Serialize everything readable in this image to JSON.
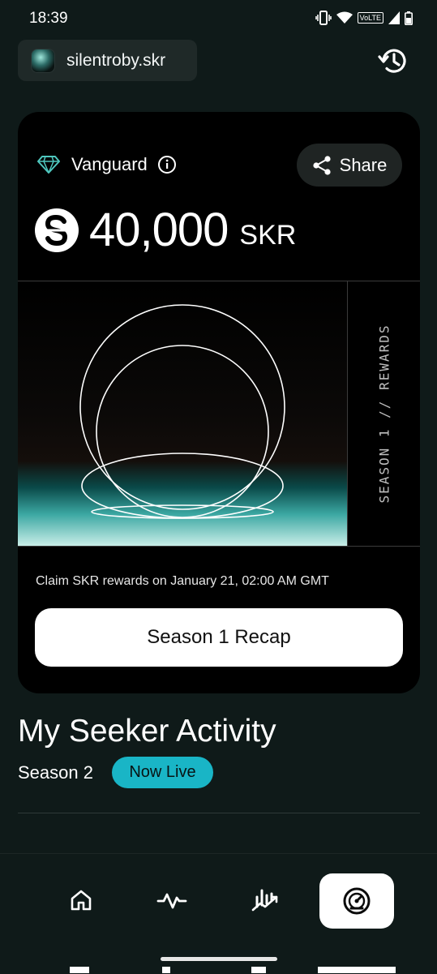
{
  "status_bar": {
    "time": "18:39",
    "network_label": "VoLTE"
  },
  "header": {
    "profile_name": "silentroby.skr",
    "icons": [
      "avatar-image",
      "history-icon"
    ]
  },
  "card": {
    "tier_label": "Vanguard",
    "share_label": "Share",
    "amount_value": "40,000",
    "amount_unit": "SKR",
    "artwork_side_text": "SEASON 1 // REWARDS",
    "claim_text": "Claim SKR rewards on January 21, 02:00 AM GMT",
    "recap_button_label": "Season 1 Recap"
  },
  "activity": {
    "title": "My Seeker Activity",
    "season_label": "Season 2",
    "badge_label": "Now Live"
  },
  "nav": {
    "items": [
      "home-icon",
      "activity-icon",
      "stats-icon",
      "dashboard-icon"
    ],
    "active_index": 3
  },
  "colors": {
    "background": "#0f1a19",
    "card": "#000000",
    "accent": "#19b5c6",
    "chip": "#1f2928"
  }
}
